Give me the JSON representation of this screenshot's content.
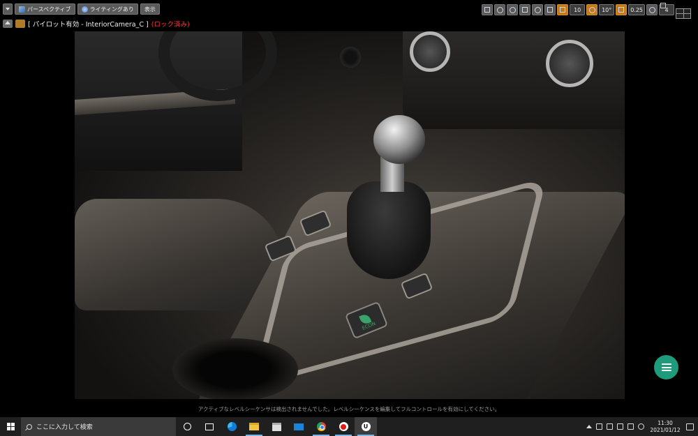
{
  "toolbar": {
    "perspective_label": "パースペクティブ",
    "lighting_label": "ライティングあり",
    "show_label": "表示",
    "grid_snap_value": "10",
    "rotation_snap_value": "10°",
    "scale_snap_value": "0.25",
    "camera_speed_value": "4"
  },
  "pilot": {
    "title": "[ パイロット有効 - InteriorCamera_C ]",
    "locked": "(ロック済み)"
  },
  "scene": {
    "eco_label": "ECON"
  },
  "status": {
    "sequencer_message": "アクティブなレベルシーケンサは検出されませんでした。レベルシーケンスを編集してフルコントロールを有効にしてください。"
  },
  "taskbar": {
    "search_placeholder": "ここに入力して検索",
    "time": "11:30",
    "date": "2021/01/12",
    "ue_glyph": "U"
  },
  "colors": {
    "fab": "#1f9a7a",
    "locked_text": "#ff3030",
    "accent_orange": "#c27a1a"
  }
}
